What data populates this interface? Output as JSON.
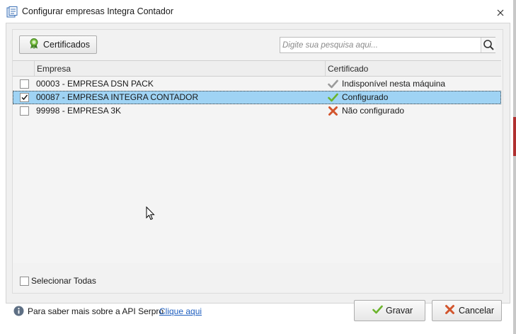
{
  "window": {
    "title": "Configurar empresas Integra Contador",
    "icons": {
      "app": "app-window-icon",
      "close": "close-icon"
    }
  },
  "toolbar": {
    "certificados_label": "Certificados",
    "certificados_icon": "certificate-ribbon-icon",
    "search_placeholder": "Digite sua pesquisa aqui...",
    "search_value": "",
    "search_icon": "search-icon"
  },
  "grid": {
    "columns": [
      "Empresa",
      "Certificado"
    ],
    "rows": [
      {
        "checked": false,
        "empresa": "00003 - EMPRESA DSN PACK",
        "certificado": "Indisponível nesta máquina",
        "status": "unavailable",
        "selected": false
      },
      {
        "checked": true,
        "empresa": "00087 - EMPRESA INTEGRA CONTADOR",
        "certificado": "Configurado",
        "status": "configured",
        "selected": true
      },
      {
        "checked": false,
        "empresa": "99998 - EMPRESA 3K",
        "certificado": "Não configurado",
        "status": "not-configured",
        "selected": false
      }
    ]
  },
  "select_all": {
    "label": "Selecionar Todas",
    "checked": false
  },
  "footer": {
    "info_text": "Para saber mais sobre a API Serpro",
    "info_link": "Clique aqui",
    "gravar_label": "Gravar",
    "cancelar_label": "Cancelar"
  },
  "colors": {
    "selection": "#9fd3f4",
    "check_green": "#6cb42c",
    "check_gray": "#9a9a9a",
    "cross_red": "#d2552d",
    "link": "#1f5fbf"
  }
}
